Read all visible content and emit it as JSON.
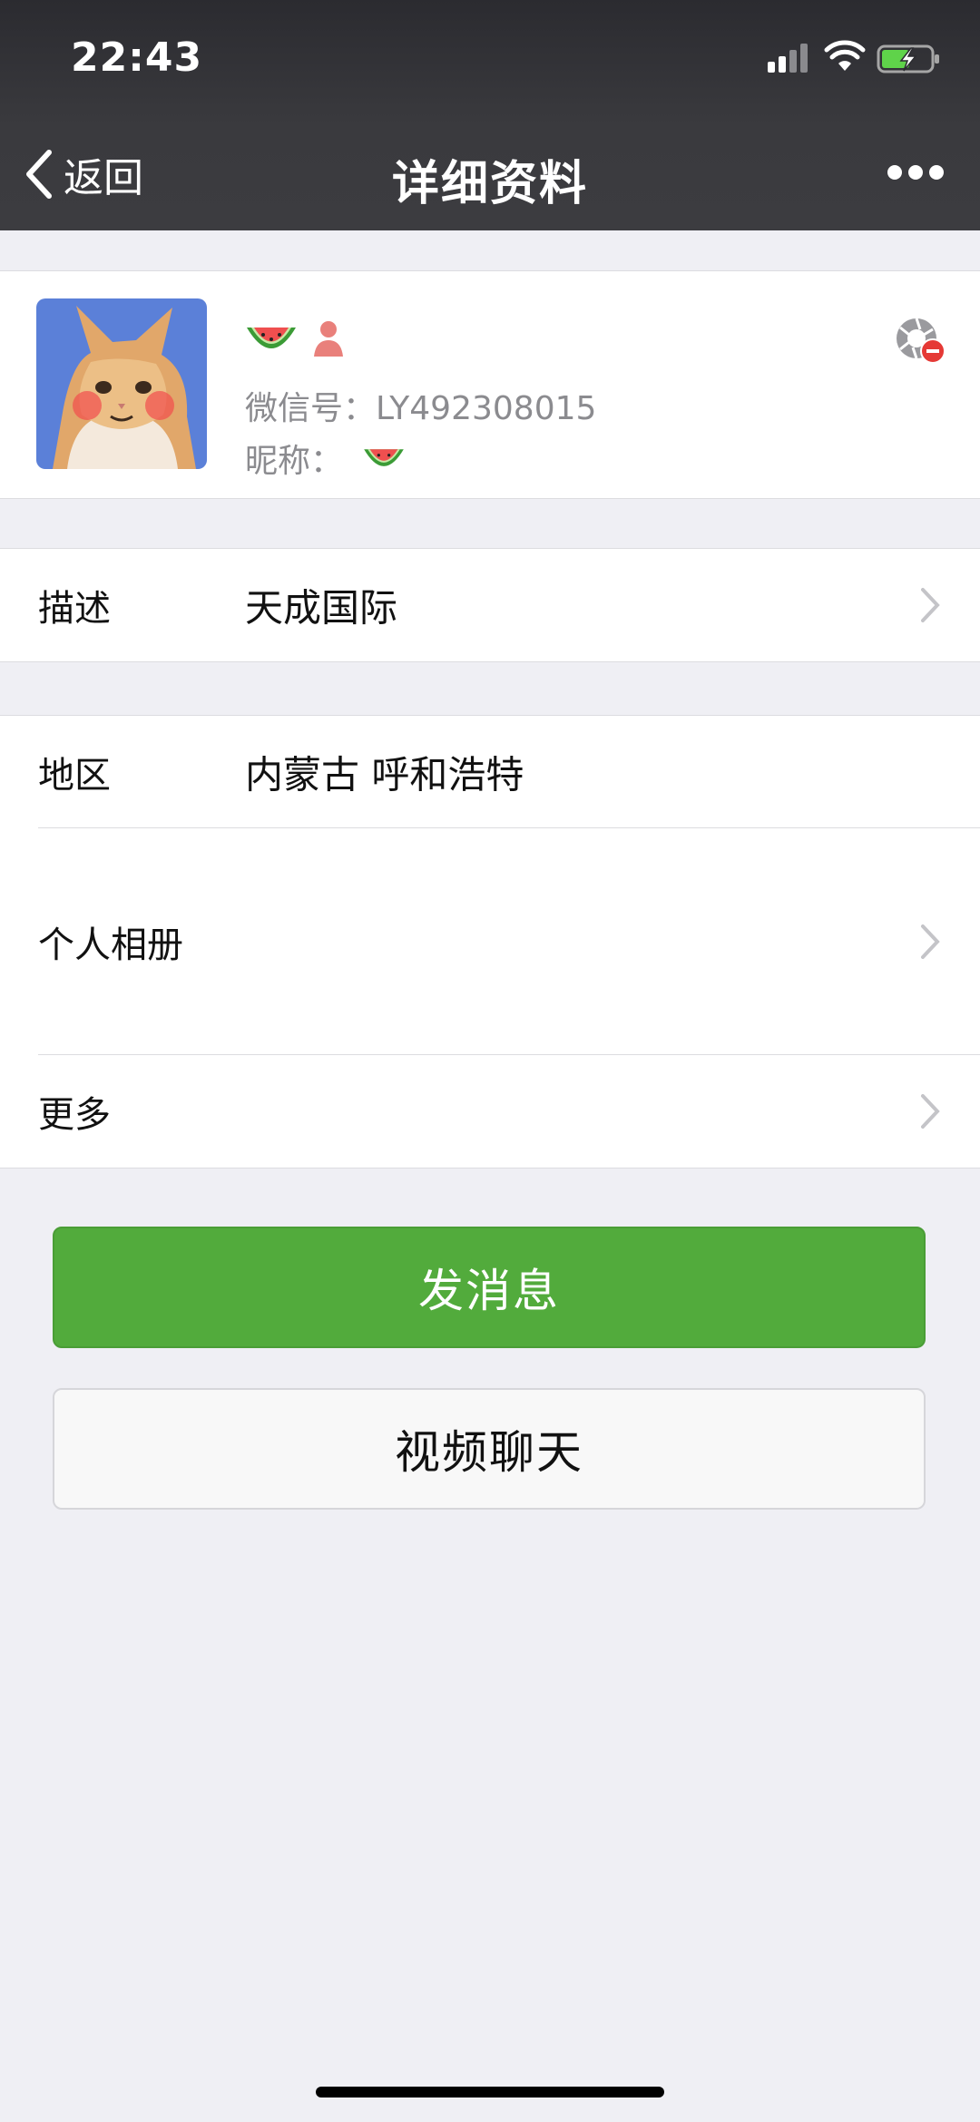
{
  "status_bar": {
    "time": "22:43"
  },
  "nav": {
    "back_label": "返回",
    "title": "详细资料"
  },
  "profile": {
    "wechat_id_label": "微信号：",
    "wechat_id": "LY492308015",
    "nickname_label": "昵称："
  },
  "rows": {
    "description": {
      "label": "描述",
      "value": "天成国际"
    },
    "region": {
      "label": "地区",
      "value": "内蒙古 呼和浩特"
    },
    "album": {
      "label": "个人相册"
    },
    "more": {
      "label": "更多"
    }
  },
  "buttons": {
    "send_message": "发消息",
    "video_call": "视频聊天"
  },
  "colors": {
    "accent_green": "#52ab3c",
    "header_bg": "#3a3a3e",
    "page_bg": "#efeff4"
  },
  "icons": [
    "back-chevron-icon",
    "more-dots-icon",
    "watermelon-icon",
    "user-silhouette-icon",
    "block-status-icon",
    "chevron-right-icon"
  ]
}
